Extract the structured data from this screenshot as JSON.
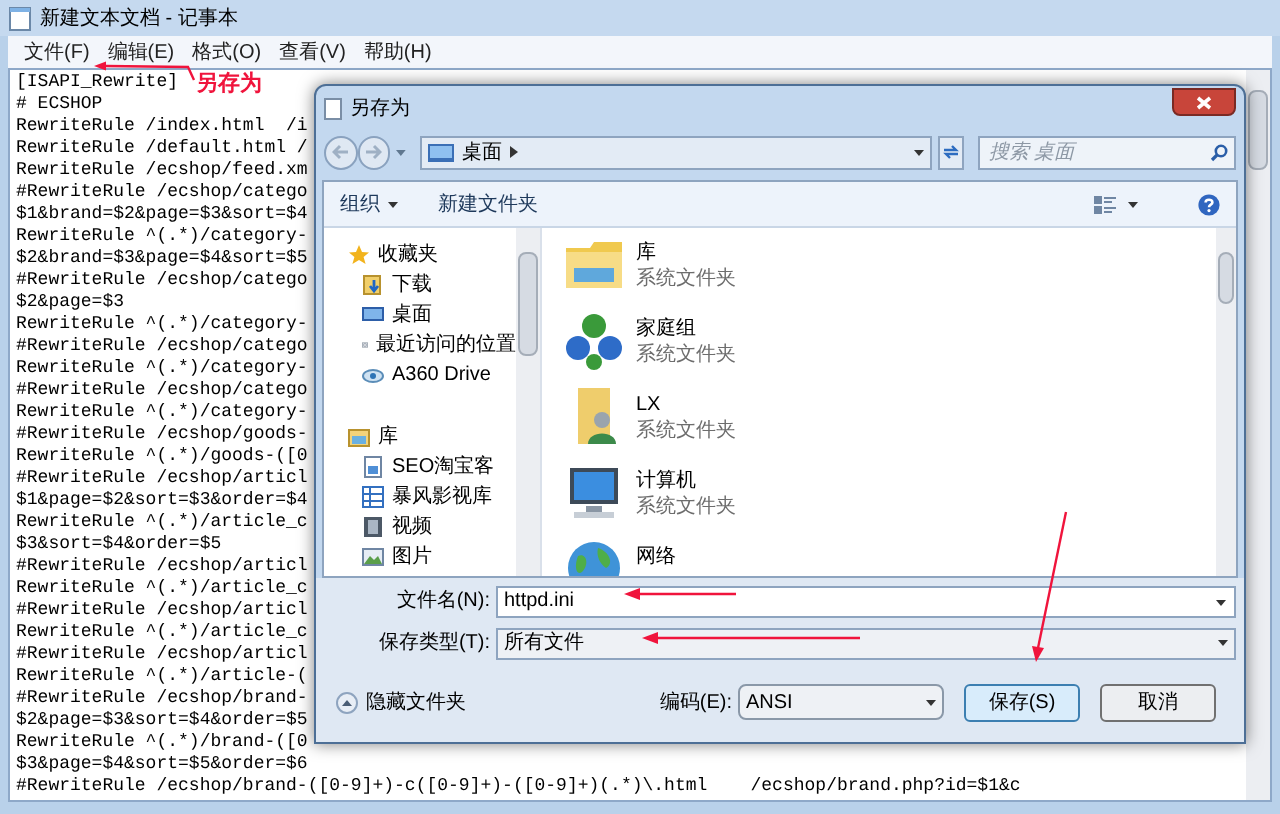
{
  "notepad": {
    "title": "新建文本文档 - 记事本",
    "menu": [
      "文件(F)",
      "编辑(E)",
      "格式(O)",
      "查看(V)",
      "帮助(H)"
    ],
    "lines": [
      "[ISAPI_Rewrite]",
      "# ECSHOP",
      "RewriteRule /index.html  /i",
      "RewriteRule /default.html /",
      "RewriteRule /ecshop/feed.xm",
      "#RewriteRule /ecshop/catego",
      "$1&brand=$2&page=$3&sort=$4",
      "RewriteRule ^(.*)/category-",
      "$2&brand=$3&page=$4&sort=$5",
      "#RewriteRule /ecshop/catego",
      "$2&page=$3",
      "RewriteRule ^(.*)/category-",
      "#RewriteRule /ecshop/catego",
      "RewriteRule ^(.*)/category-",
      "#RewriteRule /ecshop/catego",
      "RewriteRule ^(.*)/category-",
      "#RewriteRule /ecshop/goods-",
      "RewriteRule ^(.*)/goods-([0",
      "#RewriteRule /ecshop/articl",
      "$1&page=$2&sort=$3&order=$4",
      "RewriteRule ^(.*)/article_c",
      "$3&sort=$4&order=$5",
      "#RewriteRule /ecshop/articl",
      "RewriteRule ^(.*)/article_c",
      "#RewriteRule /ecshop/articl",
      "RewriteRule ^(.*)/article_c",
      "#RewriteRule /ecshop/articl",
      "RewriteRule ^(.*)/article-(",
      "#RewriteRule /ecshop/brand-",
      "$2&page=$3&sort=$4&order=$5",
      "RewriteRule ^(.*)/brand-([0",
      "$3&page=$4&sort=$5&order=$6",
      "#RewriteRule /ecshop/brand-([0-9]+)-c([0-9]+)-([0-9]+)(.*)\\.html    /ecshop/brand.php?id=$1&c"
    ]
  },
  "annotation": {
    "text": "另存为"
  },
  "dialog": {
    "title": "另存为",
    "address": "桌面",
    "search": {
      "placeholder": "搜索 桌面"
    },
    "toolbar": {
      "organize": "组织",
      "new_folder": "新建文件夹"
    },
    "nav": [
      {
        "label": "收藏夹",
        "children": [
          {
            "label": "下载"
          },
          {
            "label": "桌面"
          },
          {
            "label": "最近访问的位置"
          },
          {
            "label": "A360 Drive"
          }
        ]
      },
      {
        "label": "库",
        "children": [
          {
            "label": "SEO淘宝客"
          },
          {
            "label": "暴风影视库"
          },
          {
            "label": "视频"
          },
          {
            "label": "图片"
          }
        ]
      }
    ],
    "items": [
      {
        "name": "库",
        "type": "系统文件夹"
      },
      {
        "name": "家庭组",
        "type": "系统文件夹"
      },
      {
        "name": "LX",
        "type": "系统文件夹"
      },
      {
        "name": "计算机",
        "type": "系统文件夹"
      },
      {
        "name": "网络"
      }
    ],
    "filename_label": "文件名(N):",
    "filename": "httpd.ini",
    "filetype_label": "保存类型(T):",
    "filetype": "所有文件",
    "hide_folders": "隐藏文件夹",
    "encoding_label": "编码(E):",
    "encoding": "ANSI",
    "save": "保存(S)",
    "cancel": "取消"
  }
}
